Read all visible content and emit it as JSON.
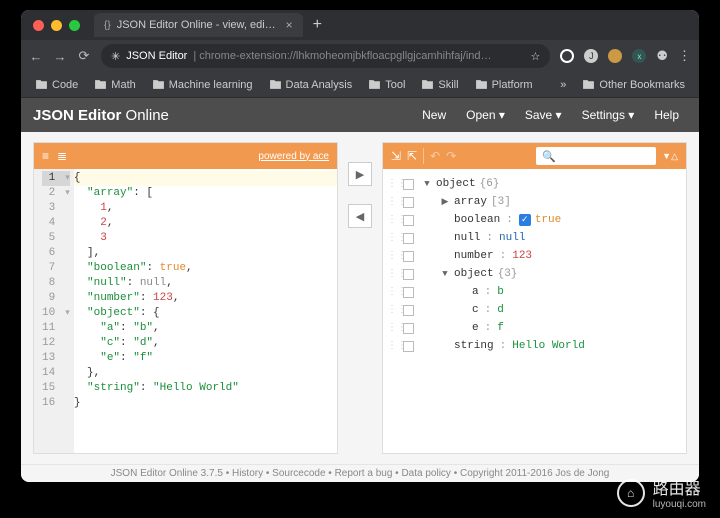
{
  "browser": {
    "tab_title": "JSON Editor Online - view, edi…",
    "nav": {
      "back": "←",
      "forward": "→",
      "reload": "⟳"
    },
    "address": {
      "extension_badge": "✳",
      "site_name": "JSON Editor",
      "url_rest": "chrome-extension://lhkmoheomjbkfloacpgllgjcamhihfaj/ind…",
      "star": "☆"
    },
    "bookmarks": [
      "Code",
      "Math",
      "Machine learning",
      "Data Analysis",
      "Tool",
      "Skill",
      "Platform"
    ],
    "other_bookmarks_label": "Other Bookmarks",
    "overflow": "»"
  },
  "app": {
    "logo_bold": "JSON Editor",
    "logo_light": " Online",
    "menu": [
      {
        "label": "New",
        "caret": ""
      },
      {
        "label": "Open",
        "caret": "▾"
      },
      {
        "label": "Save",
        "caret": "▾"
      },
      {
        "label": "Settings",
        "caret": "▾"
      },
      {
        "label": "Help",
        "caret": ""
      }
    ]
  },
  "code_panel": {
    "powered_by": "powered by ace",
    "lines": [
      {
        "n": 1,
        "fold": "▾",
        "text": "{",
        "active": true
      },
      {
        "n": 2,
        "fold": "▾",
        "html": "  <span class='str'>\"array\"</span>: ["
      },
      {
        "n": 3,
        "html": "    <span class='num'>1</span>,"
      },
      {
        "n": 4,
        "html": "    <span class='num'>2</span>,"
      },
      {
        "n": 5,
        "html": "    <span class='num'>3</span>"
      },
      {
        "n": 6,
        "html": "  ],"
      },
      {
        "n": 7,
        "html": "  <span class='str'>\"boolean\"</span>: <span class='kw'>true</span>,"
      },
      {
        "n": 8,
        "html": "  <span class='str'>\"null\"</span>: <span class='null'>null</span>,"
      },
      {
        "n": 9,
        "html": "  <span class='str'>\"number\"</span>: <span class='num'>123</span>,"
      },
      {
        "n": 10,
        "fold": "▾",
        "html": "  <span class='str'>\"object\"</span>: {"
      },
      {
        "n": 11,
        "html": "    <span class='str'>\"a\"</span>: <span class='str'>\"b\"</span>,"
      },
      {
        "n": 12,
        "html": "    <span class='str'>\"c\"</span>: <span class='str'>\"d\"</span>,"
      },
      {
        "n": 13,
        "html": "    <span class='str'>\"e\"</span>: <span class='str'>\"f\"</span>"
      },
      {
        "n": 14,
        "html": "  },"
      },
      {
        "n": 15,
        "html": "  <span class='str'>\"string\"</span>: <span class='str'>\"Hello World\"</span>"
      },
      {
        "n": 16,
        "html": "}"
      }
    ]
  },
  "transfer": {
    "to_tree": "▶",
    "to_code": "◀"
  },
  "tree_panel": {
    "search_icon": "🔍",
    "rows": [
      {
        "indent": 0,
        "caret": "▼",
        "key": "object",
        "count": "{6}"
      },
      {
        "indent": 1,
        "caret": "▶",
        "key": "array",
        "count": "[3]"
      },
      {
        "indent": 1,
        "key": "boolean",
        "sep": ":",
        "checkbox": true,
        "val": "true",
        "cls": "val-bool"
      },
      {
        "indent": 1,
        "key": "null",
        "sep": ":",
        "val": "null",
        "cls": "val-null"
      },
      {
        "indent": 1,
        "key": "number",
        "sep": ":",
        "val": "123",
        "cls": "val-num"
      },
      {
        "indent": 1,
        "caret": "▼",
        "key": "object",
        "count": "{3}"
      },
      {
        "indent": 2,
        "key": "a",
        "sep": ":",
        "val": "b",
        "cls": "val-str"
      },
      {
        "indent": 2,
        "key": "c",
        "sep": ":",
        "val": "d",
        "cls": "val-str"
      },
      {
        "indent": 2,
        "key": "e",
        "sep": ":",
        "val": "f",
        "cls": "val-str"
      },
      {
        "indent": 1,
        "key": "string",
        "sep": ":",
        "val": "Hello World",
        "cls": "val-str"
      }
    ]
  },
  "footer": "JSON Editor Online 3.7.5 • History • Sourcecode • Report a bug • Data policy • Copyright 2011-2016 Jos de Jong",
  "watermark": {
    "title": "路由器",
    "domain": "luyouqi.com"
  },
  "colors": {
    "red": "#ff5f57",
    "yellow": "#febc2e",
    "green": "#28c840"
  }
}
